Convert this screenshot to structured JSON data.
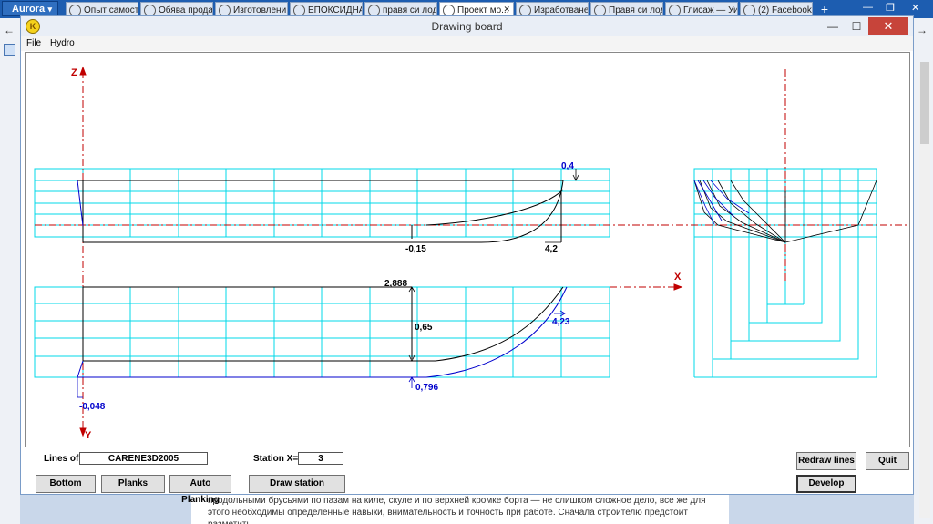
{
  "browser": {
    "menu_label": "Aurora",
    "tabs": [
      {
        "label": "Опыт самост...",
        "icon": "opera-icon"
      },
      {
        "label": "Обява прода...",
        "icon": "page-icon"
      },
      {
        "label": "Изготовлени...",
        "icon": "opera-icon"
      },
      {
        "label": "ЕПОКСИДНА...",
        "icon": "page-icon"
      },
      {
        "label": "правя си лод...",
        "icon": "google-icon"
      },
      {
        "label": "Проект мо...",
        "icon": "opera-icon",
        "active": true
      },
      {
        "label": "Изработване ...",
        "icon": "page-icon"
      },
      {
        "label": "Правя си лод...",
        "icon": "opera-icon"
      },
      {
        "label": "Глисаж — Уи...",
        "icon": "wikipedia-icon"
      },
      {
        "label": "(2) Facebook",
        "icon": "facebook-icon"
      }
    ],
    "new_tab": "+",
    "page_text_line1": "продольными брусьями по пазам на киле, скуле и по верхней кромке борта — не слишком сложное дело, все же для",
    "page_text_line2": "этого необходимы определенные навыки, внимательность и точность при работе. Сначала строителю предстоит разметить"
  },
  "window": {
    "title": "Drawing board",
    "minimize": "—",
    "maximize": "☐",
    "close": "✕",
    "menu": [
      "File",
      "Hydro"
    ]
  },
  "drawing": {
    "axis_z": "Z",
    "axis_x": "X",
    "axis_y": "Y",
    "dim_top_right": "0,4",
    "dim_keel_depth": "-0,15",
    "dim_length_top": "4,2",
    "dim_beam": "2,888",
    "dim_height": "0,65",
    "dim_length_bottom": "4,23",
    "dim_bottom_start": "-0,048",
    "dim_bottom_width": "0,796"
  },
  "controls": {
    "lines_of_label": "Lines of",
    "lines_of_value": "CARENE3D2005",
    "station_label": "Station X=",
    "station_value": "3",
    "buttons": {
      "bottom": "Bottom",
      "planks": "Planks",
      "auto_planking": "Auto Planking",
      "draw_station": "Draw station",
      "redraw_lines": "Redraw lines",
      "quit": "Quit",
      "develop": "Develop"
    }
  },
  "colors": {
    "grid": "#00d8e8",
    "axis": "#c00000",
    "hull_line": "#000000",
    "dimension": "#0000cc"
  }
}
